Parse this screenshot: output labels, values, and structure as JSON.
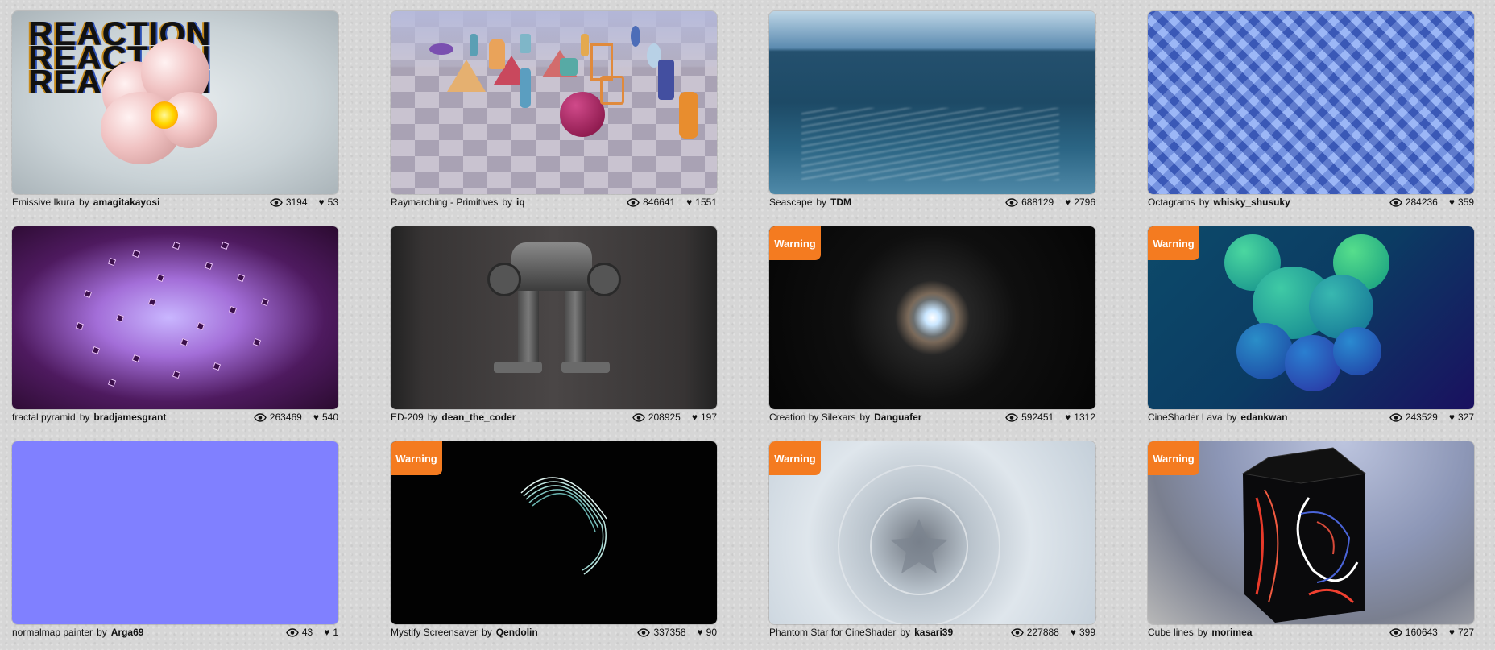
{
  "warning_label": "Warning",
  "by_label": "by",
  "shaders": [
    {
      "title": "Emissive Ikura",
      "author": "amagitakayosi",
      "views": "3194",
      "likes": "53",
      "warning": false,
      "thumb_text": "REACTION"
    },
    {
      "title": "Raymarching - Primitives",
      "author": "iq",
      "views": "846641",
      "likes": "1551",
      "warning": false
    },
    {
      "title": "Seascape",
      "author": "TDM",
      "views": "688129",
      "likes": "2796",
      "warning": false
    },
    {
      "title": "Octagrams",
      "author": "whisky_shusuky",
      "views": "284236",
      "likes": "359",
      "warning": false
    },
    {
      "title": "fractal pyramid",
      "author": "bradjamesgrant",
      "views": "263469",
      "likes": "540",
      "warning": false
    },
    {
      "title": "ED-209",
      "author": "dean_the_coder",
      "views": "208925",
      "likes": "197",
      "warning": false
    },
    {
      "title": "Creation by Silexars",
      "author": "Danguafer",
      "views": "592451",
      "likes": "1312",
      "warning": true
    },
    {
      "title": "CineShader Lava",
      "author": "edankwan",
      "views": "243529",
      "likes": "327",
      "warning": true
    },
    {
      "title": "normalmap painter",
      "author": "Arga69",
      "views": "43",
      "likes": "1",
      "warning": false
    },
    {
      "title": "Mystify Screensaver",
      "author": "Qendolin",
      "views": "337358",
      "likes": "90",
      "warning": true
    },
    {
      "title": "Phantom Star for CineShader",
      "author": "kasari39",
      "views": "227888",
      "likes": "399",
      "warning": true
    },
    {
      "title": "Cube lines",
      "author": "morimea",
      "views": "160643",
      "likes": "727",
      "warning": true
    }
  ]
}
